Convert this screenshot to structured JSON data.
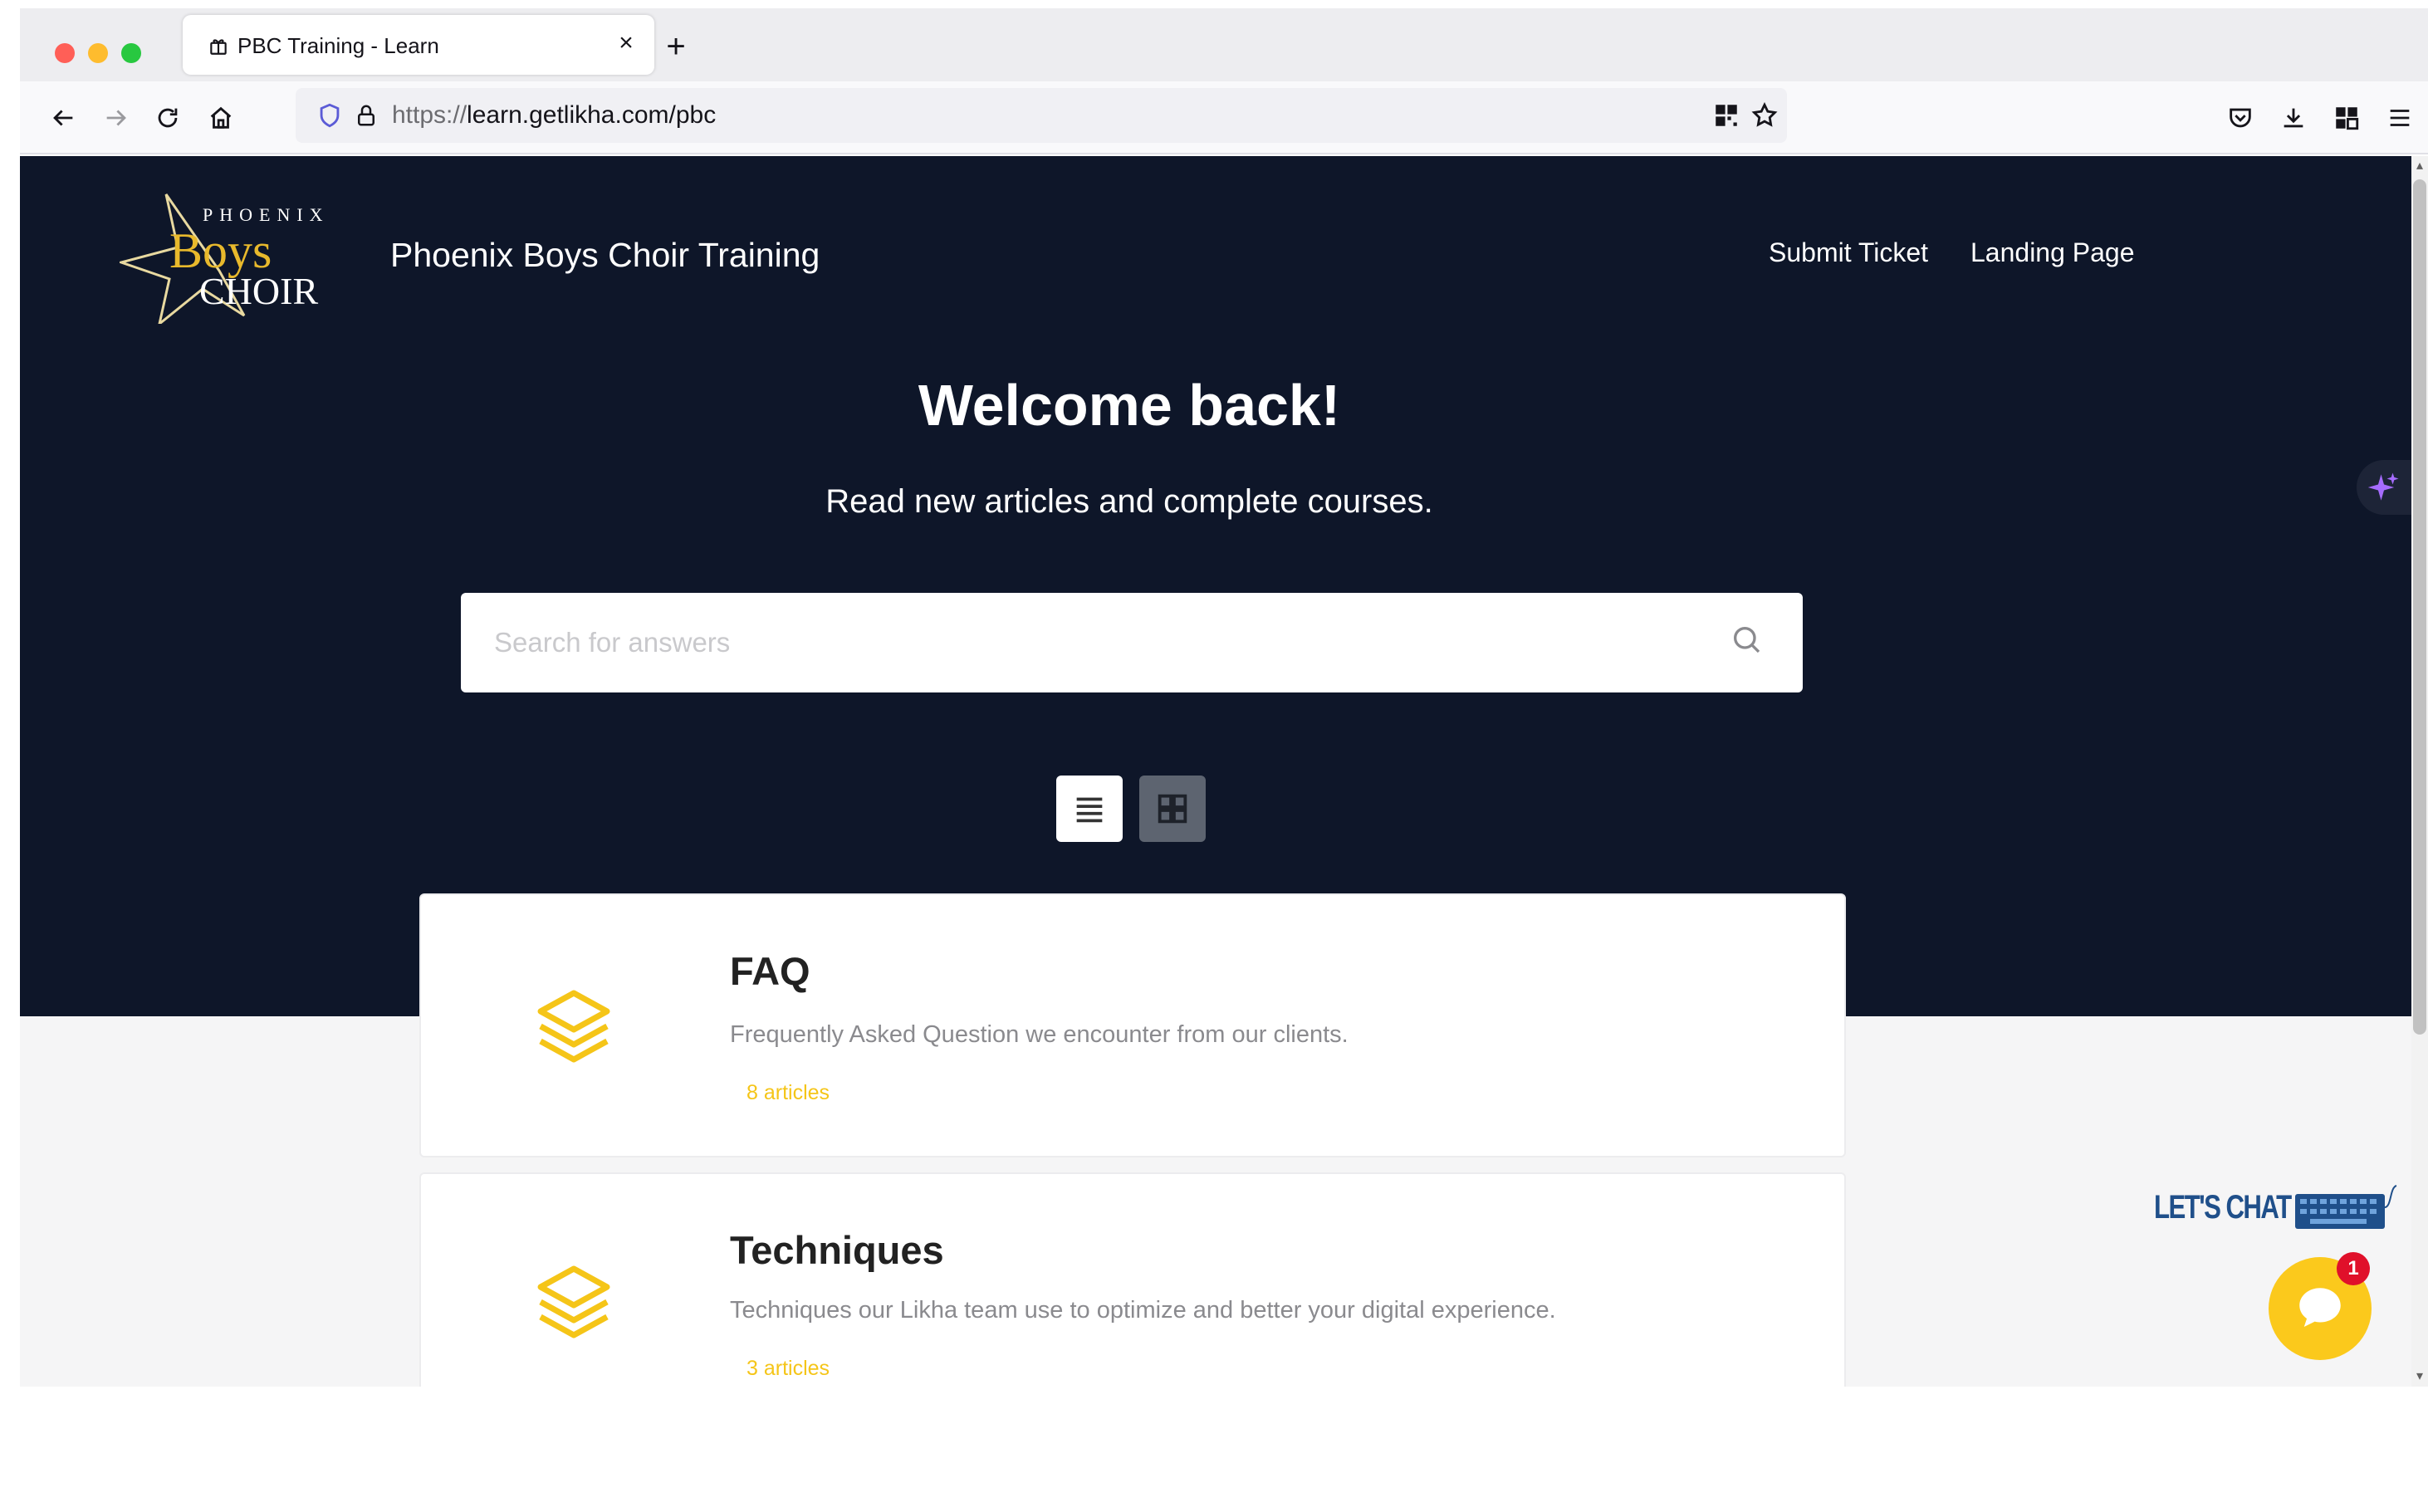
{
  "browser": {
    "tab_title": "PBC Training - Learn",
    "new_tab_label": "+",
    "close_tab_label": "×",
    "url_protocol": "https://",
    "url_path": "learn.getlikha.com/pbc"
  },
  "site": {
    "title": "Phoenix Boys Choir Training",
    "logo_text_top": "PHOENIX",
    "logo_text_main": "Boys",
    "logo_text_sub": "CHOIR",
    "nav": {
      "submit_ticket": "Submit Ticket",
      "landing_page": "Landing Page"
    }
  },
  "hero": {
    "heading": "Welcome back!",
    "subheading": "Read new articles and complete courses."
  },
  "search": {
    "placeholder": "Search for answers",
    "value": ""
  },
  "view_toggle": {
    "selected": "list"
  },
  "cards": [
    {
      "title": "FAQ",
      "description": "Frequently Asked Question we encounter from our clients.",
      "count": "8 articles"
    },
    {
      "title": "Techniques",
      "description": "Techniques our Likha team use to optimize and better your digital experience.",
      "count": "3 articles"
    }
  ],
  "chat": {
    "label": "LET'S CHAT",
    "badge": "1"
  },
  "colors": {
    "hero_bg": "#0e1629",
    "accent_yellow": "#f5c518",
    "chat_yellow": "#fbc91c",
    "badge_red": "#e0102a",
    "ai_purple": "#a66cff"
  },
  "icons": {
    "tab": "gift-icon",
    "back": "arrow-left-icon",
    "forward": "arrow-right-icon",
    "reload": "reload-icon",
    "home": "home-icon",
    "shield": "shield-icon",
    "lock": "lock-icon",
    "qr": "qr-code-icon",
    "bookmark": "star-icon",
    "pocket": "pocket-icon",
    "download": "download-icon",
    "extensions": "extensions-icon",
    "menu": "hamburger-menu-icon",
    "search": "search-icon",
    "list_view": "list-icon",
    "grid_view": "grid-icon",
    "category": "layers-icon",
    "ai": "sparkle-icon",
    "chat": "chat-bubble-icon"
  }
}
